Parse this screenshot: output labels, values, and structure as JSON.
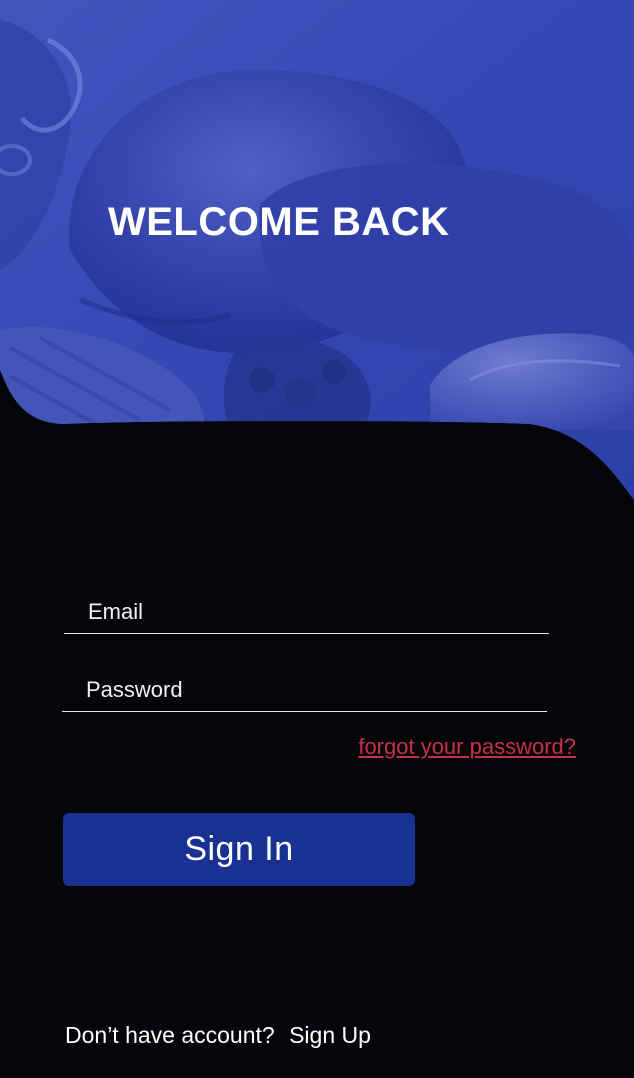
{
  "header": {
    "title": "WELCOME BACK",
    "background_image": "food-photo-blue-overlay"
  },
  "form": {
    "email_placeholder": "Email",
    "password_placeholder": "Password",
    "forgot_password_label": "forgot your password?",
    "sign_in_label": "Sign In"
  },
  "footer": {
    "prompt": "Don’t have account?",
    "sign_up_label": "Sign Up"
  },
  "colors": {
    "background": "#05060a",
    "overlay": "#3248b8",
    "primary_button": "#1a3194",
    "link": "#c83045",
    "text": "#ffffff"
  }
}
